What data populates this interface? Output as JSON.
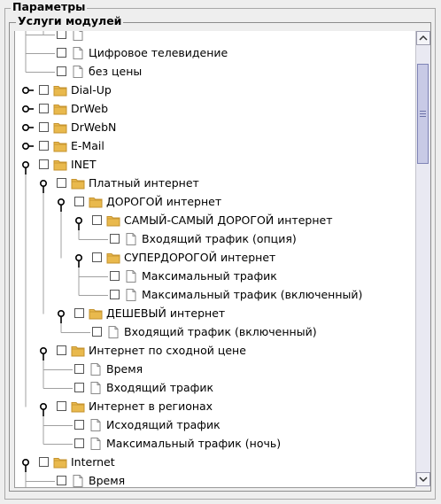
{
  "panel": {
    "title": "Параметры"
  },
  "group": {
    "title": "Услуги модулей"
  },
  "icons": {
    "folder": "folder-icon",
    "file": "file-icon",
    "handle": "tree-handle-icon"
  },
  "colors": {
    "folder": "#e9b94d",
    "folder_dark": "#c4922d",
    "thumb": "#c8cae6"
  },
  "tree": [
    {
      "level": 1,
      "type": "file",
      "label": "",
      "handle": "none",
      "checked": false,
      "partial": true
    },
    {
      "level": 1,
      "type": "file",
      "label": "Цифровое телевидение",
      "handle": "none",
      "checked": false
    },
    {
      "level": 1,
      "type": "file",
      "label": "без цены",
      "handle": "none",
      "checked": false
    },
    {
      "level": 0,
      "type": "folder",
      "label": "Dial-Up",
      "handle": "collapsed",
      "checked": false
    },
    {
      "level": 0,
      "type": "folder",
      "label": "DrWeb",
      "handle": "collapsed",
      "checked": false
    },
    {
      "level": 0,
      "type": "folder",
      "label": "DrWebN",
      "handle": "collapsed",
      "checked": false
    },
    {
      "level": 0,
      "type": "folder",
      "label": "E-Mail",
      "handle": "collapsed",
      "checked": false
    },
    {
      "level": 0,
      "type": "folder",
      "label": "INET",
      "handle": "expanded",
      "checked": false
    },
    {
      "level": 1,
      "type": "folder",
      "label": "Платный интернет",
      "handle": "expanded",
      "checked": false
    },
    {
      "level": 2,
      "type": "folder",
      "label": "ДОРОГОЙ интернет",
      "handle": "expanded",
      "checked": false
    },
    {
      "level": 3,
      "type": "folder",
      "label": "САМЫЙ-САМЫЙ ДОРОГОЙ интернет",
      "handle": "expanded",
      "checked": false
    },
    {
      "level": 4,
      "type": "file",
      "label": "Входящий трафик (опция)",
      "handle": "none",
      "checked": false
    },
    {
      "level": 3,
      "type": "folder",
      "label": "СУПЕРДОРОГОЙ интернет",
      "handle": "expanded",
      "checked": false
    },
    {
      "level": 4,
      "type": "file",
      "label": "Максимальный трафик",
      "handle": "none",
      "checked": false
    },
    {
      "level": 4,
      "type": "file",
      "label": "Максимальный трафик (включенный)",
      "handle": "none",
      "checked": false
    },
    {
      "level": 2,
      "type": "folder",
      "label": "ДЕШЕВЫЙ интернет",
      "handle": "expanded",
      "checked": false
    },
    {
      "level": 3,
      "type": "file",
      "label": "Входящий трафик (включенный)",
      "handle": "none",
      "checked": false
    },
    {
      "level": 1,
      "type": "folder",
      "label": "Интернет по сходной цене",
      "handle": "expanded",
      "checked": false
    },
    {
      "level": 2,
      "type": "file",
      "label": "Время",
      "handle": "none",
      "checked": false
    },
    {
      "level": 2,
      "type": "file",
      "label": "Входящий трафик",
      "handle": "none",
      "checked": false
    },
    {
      "level": 1,
      "type": "folder",
      "label": "Интернет в регионах",
      "handle": "expanded",
      "checked": false
    },
    {
      "level": 2,
      "type": "file",
      "label": "Исходящий трафик",
      "handle": "none",
      "checked": false
    },
    {
      "level": 2,
      "type": "file",
      "label": "Максимальный трафик (ночь)",
      "handle": "none",
      "checked": false
    },
    {
      "level": 0,
      "type": "folder",
      "label": "Internet",
      "handle": "expanded",
      "checked": false
    },
    {
      "level": 1,
      "type": "file",
      "label": "Время",
      "handle": "none",
      "checked": false
    }
  ]
}
